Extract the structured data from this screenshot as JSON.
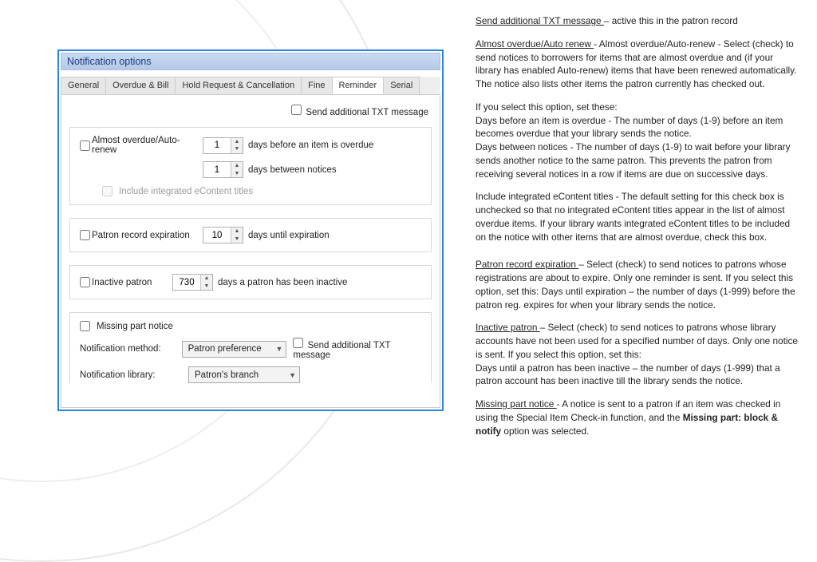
{
  "panel": {
    "title": "Notification options",
    "tabs": [
      "General",
      "Overdue & Bill",
      "Hold Request & Cancellation",
      "Fine",
      "Reminder",
      "Serial"
    ],
    "active_tab": 4,
    "top_checkbox": "Send additional TXT message",
    "almost_overdue": {
      "label": "Almost overdue/Auto-renew",
      "days_before_val": "1",
      "days_before_suffix": "days before an item is overdue",
      "days_between_val": "1",
      "days_between_suffix": "days between notices",
      "include_econtent": "Include integrated eContent titles"
    },
    "patron_expiration": {
      "label": "Patron record expiration",
      "val": "10",
      "suffix": "days until expiration"
    },
    "inactive": {
      "label": "Inactive patron",
      "val": "730",
      "suffix": "days a patron has been inactive"
    },
    "missing_part": {
      "label": "Missing part notice",
      "method_label": "Notification method:",
      "method_value": "Patron preference",
      "method_txt": "Send additional TXT message",
      "library_label": "Notification library:",
      "library_value": "Patron's branch"
    }
  },
  "doc": {
    "p1a": "Send additional TXT message ",
    "p1b": "– active this in the patron record",
    "p2a": "Almost overdue/Auto renew ",
    "p2b": "- Almost overdue/Auto-renew - Select (check) to send notices to borrowers for items that are almost overdue and (if your library has enabled Auto-renew) items that have been renewed automatically. The notice also lists other items the patron currently has checked out.",
    "p3a": "If you select this option, set these:",
    "p3b": "Days before an item is overdue - The number of days (1-9) before an item becomes overdue that your library sends the notice.",
    "p3c": "Days between notices - The number of days (1-9) to wait before your library sends another notice to the same patron. This prevents the patron from receiving several notices in a row if items are due on successive days.",
    "p4": "Include integrated eContent titles - The default setting for this check box is unchecked so that no integrated eContent titles appear in the list of almost overdue items. If your library wants integrated eContent titles to be included on the notice with other items that are almost overdue, check this box.",
    "p5a": "Patron record expiration ",
    "p5b": "– Select (check) to send notices to patrons whose registrations are about to expire. Only one reminder is sent. If you select this option, set this: Days until expiration – the number of days (1-999) before the patron reg. expires for when your library sends the notice.",
    "p6a": "Inactive patron ",
    "p6b": "– Select (check) to send notices to patrons whose library accounts have not been used for a specified number of days. Only one notice is sent. If you select this option, set this:",
    "p6c": "Days until a patron has been inactive – the number of days (1-999) that a patron account has been inactive till the library sends the notice.",
    "p7a": "Missing part notice ",
    "p7b": "- A notice is sent to a patron if an item was checked in using the Special Item Check-in function, and the ",
    "p7c": "Missing part: block & notify",
    "p7d": " option was selected."
  }
}
